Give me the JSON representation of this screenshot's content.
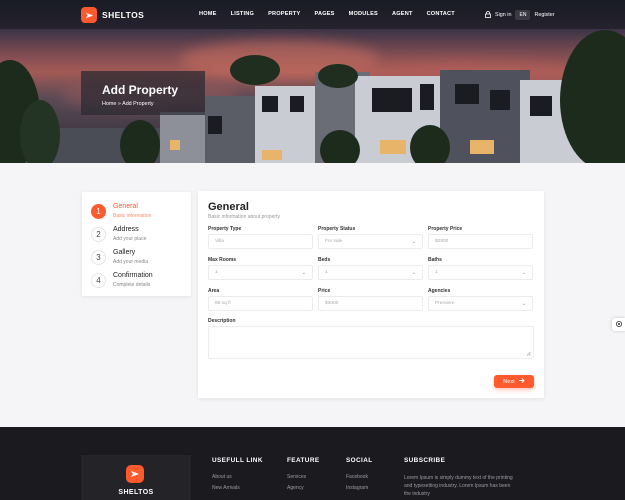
{
  "brand": {
    "name": "SHELTOS",
    "accent": "#ff5a2d"
  },
  "nav": {
    "items": [
      "HOME",
      "LISTING",
      "PROPERTY",
      "PAGES",
      "MODULES",
      "AGENT",
      "CONTACT"
    ],
    "sign_in": "Sign in",
    "lang": "EN",
    "register": "Register"
  },
  "hero": {
    "title": "Add Property",
    "breadcrumb_home": "Home",
    "breadcrumb_sep": "»",
    "breadcrumb_current": "Add Property"
  },
  "steps": [
    {
      "num": "1",
      "title": "General",
      "subtitle": "Basic information"
    },
    {
      "num": "2",
      "title": "Address",
      "subtitle": "Add your place"
    },
    {
      "num": "3",
      "title": "Gallery",
      "subtitle": "Add your media"
    },
    {
      "num": "4",
      "title": "Confirmation",
      "subtitle": "Complete details"
    }
  ],
  "form": {
    "title": "General",
    "subtitle": "Basic information about property",
    "fields": {
      "property_type": {
        "label": "Property Type",
        "placeholder": "Villa"
      },
      "property_status": {
        "label": "Property Status",
        "value": "For sale"
      },
      "property_price": {
        "label": "Property Price",
        "placeholder": "$2800"
      },
      "max_rooms": {
        "label": "Max Rooms",
        "value": "1"
      },
      "beds": {
        "label": "Beds",
        "value": "1"
      },
      "baths": {
        "label": "Baths",
        "value": "1"
      },
      "area": {
        "label": "Area",
        "placeholder": "85 sq ft"
      },
      "price": {
        "label": "Price",
        "placeholder": "$3000"
      },
      "agencies": {
        "label": "Agencies",
        "value": "Premiere"
      },
      "description": {
        "label": "Description"
      }
    },
    "next_label": "Next"
  },
  "footer": {
    "logo_text": "SHELTOS",
    "useful": {
      "heading": "USEFULL LINK",
      "items": [
        "About us",
        "New Arrivals"
      ]
    },
    "feature": {
      "heading": "FEATURE",
      "items": [
        "Services",
        "Agency"
      ]
    },
    "social": {
      "heading": "SOCIAL",
      "items": [
        "Facebook",
        "Instagram"
      ]
    },
    "subscribe": {
      "heading": "SUBSCRIBE",
      "text": "Lorem Ipsum is simply dummy text of the printing and typesetting industry. Lorem Ipsum has been the industry"
    }
  }
}
